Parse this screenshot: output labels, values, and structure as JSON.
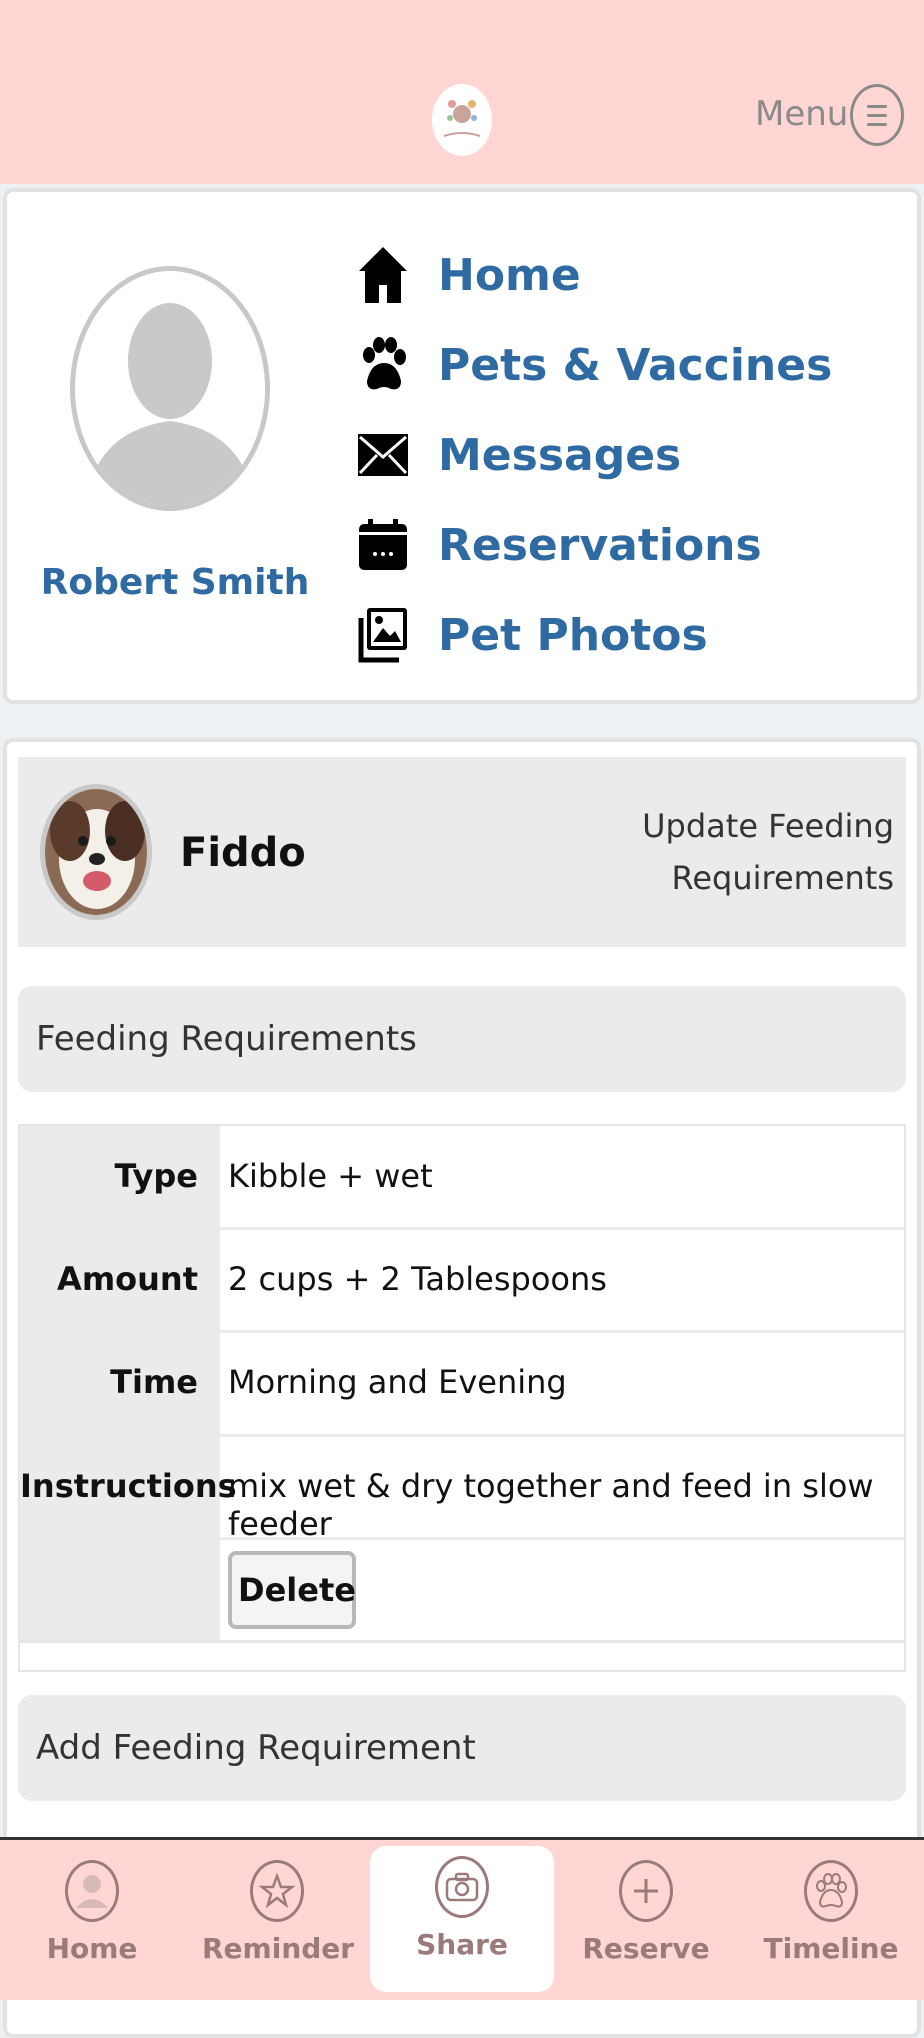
{
  "header": {
    "menu_label": "Menu"
  },
  "profile": {
    "name": "Robert Smith"
  },
  "nav": {
    "items": [
      {
        "label": "Home",
        "icon": "house-icon"
      },
      {
        "label": "Pets & Vaccines",
        "icon": "paw-icon"
      },
      {
        "label": "Messages",
        "icon": "envelope-icon"
      },
      {
        "label": "Reservations",
        "icon": "calendar-icon"
      },
      {
        "label": "Pet Photos",
        "icon": "photos-icon"
      }
    ]
  },
  "pet": {
    "name": "Fiddo",
    "update_link": "Update Feeding Requirements"
  },
  "feeding": {
    "section_title": "Feeding Requirements",
    "rows": [
      {
        "label": "Type",
        "value": "Kibble + wet"
      },
      {
        "label": "Amount",
        "value": "2 cups + 2 Tablespoons"
      },
      {
        "label": "Time",
        "value": "Morning and Evening"
      },
      {
        "label": "Instructions",
        "value": "mix wet & dry together and feed in slow feeder"
      }
    ],
    "delete_label": "Delete",
    "add_label": "Add Feeding Requirement"
  },
  "tabs": [
    {
      "label": "Home",
      "icon": "user-icon"
    },
    {
      "label": "Reminder",
      "icon": "star-icon"
    },
    {
      "label": "Share",
      "icon": "camera-icon",
      "active": true
    },
    {
      "label": "Reserve",
      "icon": "plus-icon"
    },
    {
      "label": "Timeline",
      "icon": "paw-icon"
    }
  ],
  "colors": {
    "header_bg": "#ffd6d4",
    "link_blue": "#2f6aa3",
    "tab_text": "#9a7a7a"
  }
}
